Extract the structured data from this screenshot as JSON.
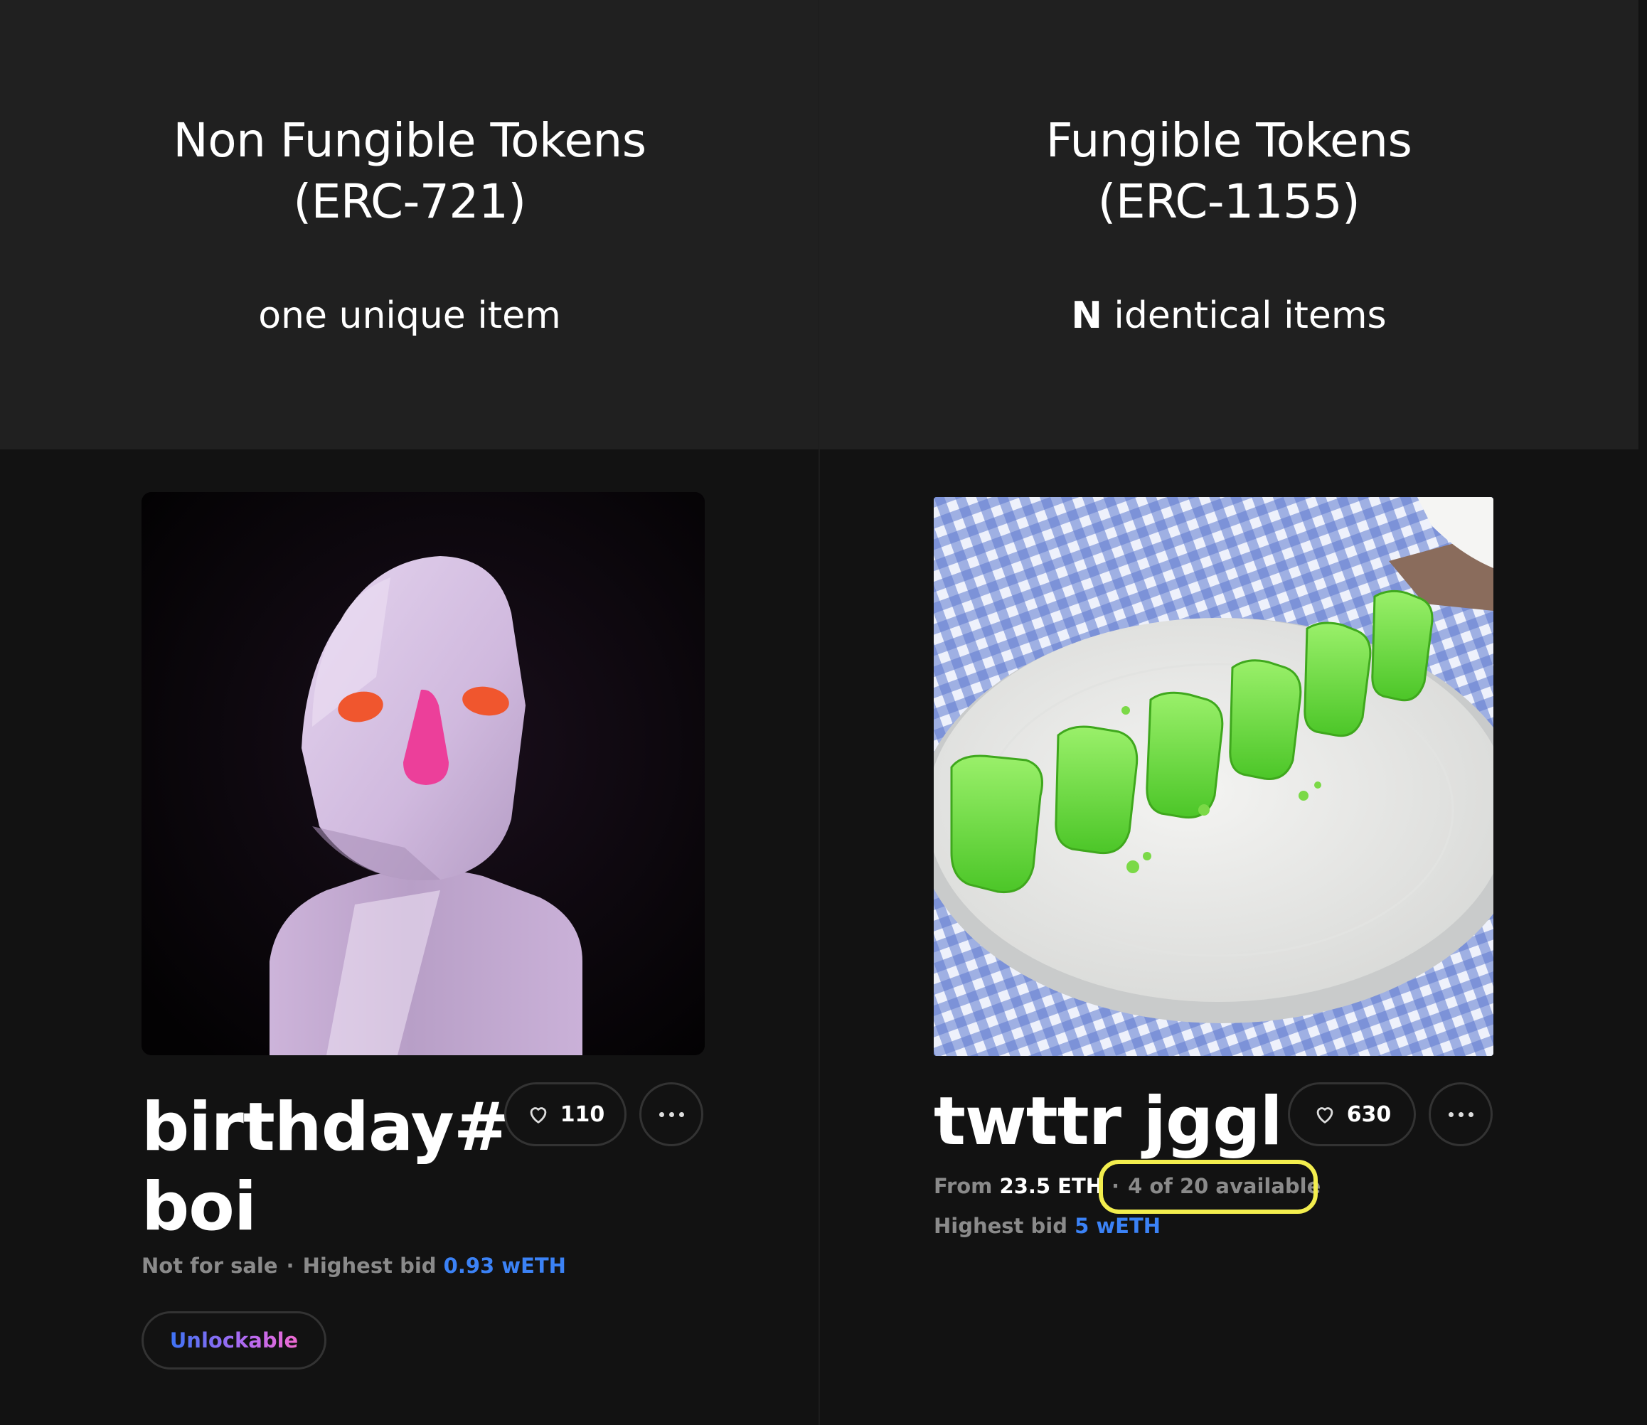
{
  "left": {
    "title_line1": "Non Fungible Tokens",
    "title_line2": "(ERC-721)",
    "subtitle": "one unique item",
    "card": {
      "title_line1": "birthday#",
      "title_line2": "boi",
      "likes": "110",
      "status": "Not for sale",
      "bid_label": "Highest bid",
      "bid_value": "0.93 wETH",
      "badge": "Unlockable"
    }
  },
  "right": {
    "title_line1": "Fungible Tokens",
    "title_line2": "(ERC-1155)",
    "subtitle_prefix": "N",
    "subtitle_rest": "identical items",
    "card": {
      "title": "twttr jggl",
      "likes": "630",
      "price_label": "From",
      "price_value": "23.5 ETH",
      "availability": "4 of 20 available",
      "bid_label": "Highest bid",
      "bid_value": "5 wETH"
    }
  },
  "colors": {
    "header_bg": "#202020",
    "page_bg": "#121212",
    "bid_accent": "#3b82f6",
    "highlight_ring": "#f3ee4e"
  },
  "icons": [
    "heart-icon",
    "more-icon"
  ]
}
